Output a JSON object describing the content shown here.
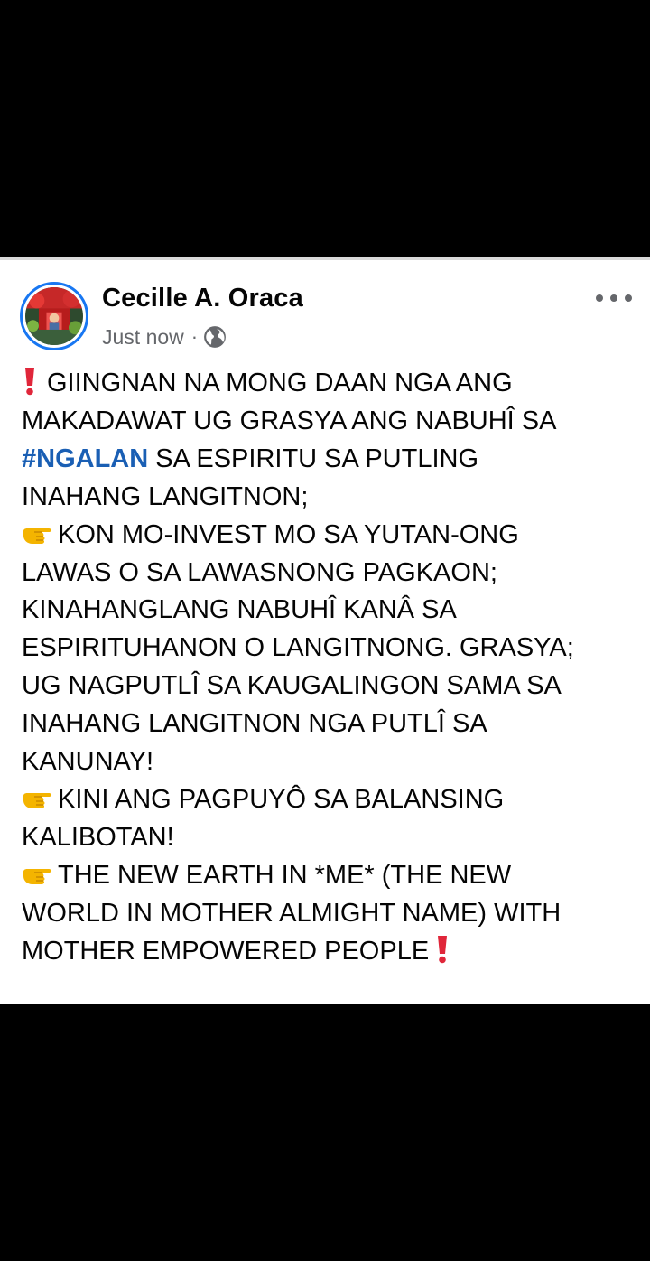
{
  "post": {
    "author": "Cecille A. Oraca",
    "timestamp": "Just now",
    "separator": "·",
    "privacy_icon": "globe-icon",
    "menu_icon": "more-options-icon",
    "hashtag": "#NGALAN",
    "colors": {
      "accent": "#1877f2",
      "hashtag": "#1a5fb4",
      "text": "#050505",
      "muted": "#65676b",
      "emoji_red": "#e0263a",
      "emoji_hand": "#f4b400"
    },
    "lines": {
      "l1": "GIINGNAN NA MONG DAAN NGA ANG",
      "l2": "MAKADAWAT UG GRASYA ANG NABUHÎ SA",
      "l3_rest": " SA ESPIRITU SA PUTLING",
      "l4": "INAHANG LANGITNON;",
      "l5": "KON MO-INVEST MO SA YUTAN-ONG",
      "l6": "LAWAS O SA LAWASNONG PAGKAON;",
      "l7": "KINAHANGLANG NABUHÎ KANÂ SA",
      "l8": "ESPIRITUHANON O LANGITNONG. GRASYA;",
      "l9": "UG NAGPUTLÎ SA KAUGALINGON SAMA SA",
      "l10": "INAHANG LANGITNON NGA PUTLÎ SA",
      "l11": "KANUNAY!",
      "l12": "KINI ANG PAGPUYÔ SA BALANSING",
      "l13": "KALIBOTAN!",
      "l14": "THE NEW EARTH IN *ME* (THE NEW",
      "l15": "WORLD IN MOTHER ALMIGHT NAME) WITH",
      "l16": "MOTHER EMPOWERED PEOPLE"
    }
  }
}
